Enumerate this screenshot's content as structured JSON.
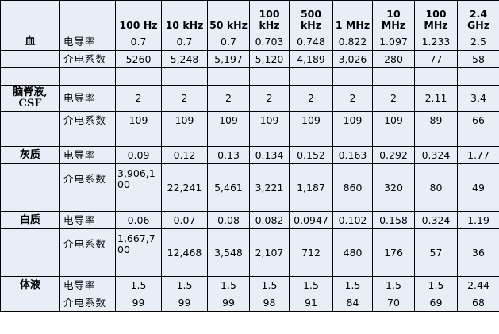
{
  "columns": [
    "100 Hz",
    "10 kHz",
    "50 kHz",
    "100 kHz",
    "500 kHz",
    "1 MHz",
    "10 MHz",
    "100 MHz",
    "2.4 GHz"
  ],
  "column_display": [
    [
      "100 Hz"
    ],
    [
      "10 kHz"
    ],
    [
      "50 kHz"
    ],
    [
      "100",
      "kHz"
    ],
    [
      "500",
      "kHz"
    ],
    [
      "1 MHz"
    ],
    [
      "10",
      "MHz"
    ],
    [
      "100",
      "MHz"
    ],
    [
      "2.4",
      "GHz"
    ]
  ],
  "tissues": [
    {
      "name": "血",
      "name_lines": [
        "血"
      ],
      "rows": [
        {
          "property": "电导率",
          "values": [
            "0.7",
            "0.7",
            "0.7",
            "0.703",
            "0.748",
            "0.822",
            "1.097",
            "1.233",
            "2.5"
          ]
        },
        {
          "property": "介电系数",
          "values": [
            "5260",
            "5,248",
            "5,197",
            "5,120",
            "4,189",
            "3,026",
            "280",
            "77",
            "58"
          ]
        }
      ]
    },
    {
      "name": "脑脊液, CSF",
      "name_lines": [
        "脑脊液,",
        "CSF"
      ],
      "rows": [
        {
          "property": "电导率",
          "values": [
            "2",
            "2",
            "2",
            "2",
            "2",
            "2",
            "2",
            "2.11",
            "3.4"
          ]
        },
        {
          "property": "介电系数",
          "values": [
            "109",
            "109",
            "109",
            "109",
            "109",
            "109",
            "109",
            "89",
            "66"
          ]
        }
      ]
    },
    {
      "name": "灰质",
      "name_lines": [
        "灰质"
      ],
      "rows": [
        {
          "property": "电导率",
          "values": [
            "0.09",
            "0.12",
            "0.13",
            "0.134",
            "0.152",
            "0.163",
            "0.292",
            "0.324",
            "1.77"
          ]
        },
        {
          "property": "介电系数",
          "values": [
            "3,906,100",
            "22,241",
            "5,461",
            "3,221",
            "1,187",
            "860",
            "320",
            "80",
            "49"
          ],
          "first_display": [
            "3,906,1",
            "00"
          ]
        }
      ]
    },
    {
      "name": "白质",
      "name_lines": [
        "白质"
      ],
      "rows": [
        {
          "property": "电导率",
          "values": [
            "0.06",
            "0.07",
            "0.08",
            "0.082",
            "0.0947",
            "0.102",
            "0.158",
            "0.324",
            "1.19"
          ]
        },
        {
          "property": "介电系数",
          "values": [
            "1,667,700",
            "12,468",
            "3,548",
            "2,107",
            "712",
            "480",
            "176",
            "57",
            "36"
          ],
          "first_display": [
            "1,667,7",
            "00"
          ]
        }
      ]
    },
    {
      "name": "体液",
      "name_lines": [
        "体液"
      ],
      "rows": [
        {
          "property": "电导率",
          "values": [
            "1.5",
            "1.5",
            "1.5",
            "1.5",
            "1.5",
            "1.5",
            "1.5",
            "1.5",
            "2.44"
          ]
        },
        {
          "property": "介电系数",
          "values": [
            "99",
            "99",
            "99",
            "98",
            "91",
            "84",
            "70",
            "69",
            "68"
          ]
        }
      ]
    }
  ]
}
